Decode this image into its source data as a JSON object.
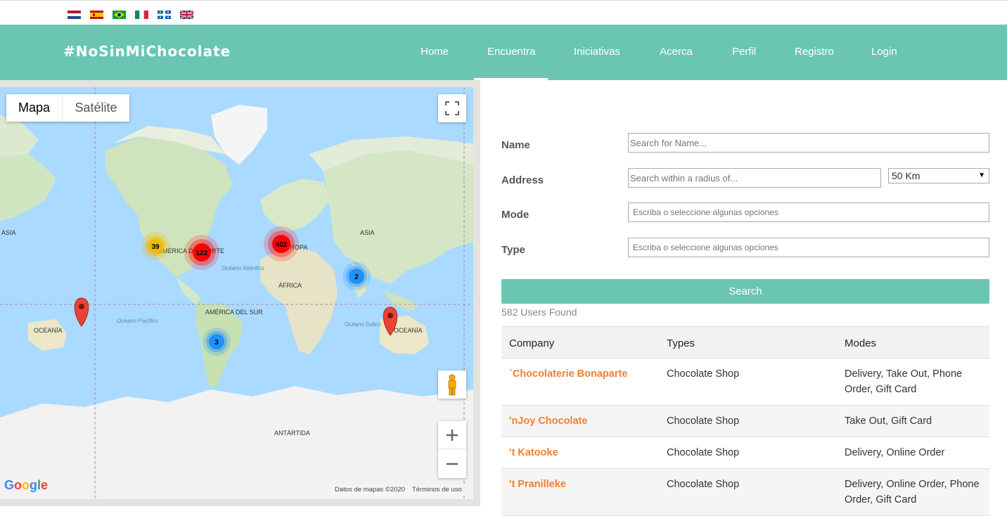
{
  "flags": [
    {
      "name": "dutch-flag-icon"
    },
    {
      "name": "spanish-flag-icon"
    },
    {
      "name": "brazilian-flag-icon"
    },
    {
      "name": "italian-flag-icon"
    },
    {
      "name": "quebec-flag-icon"
    },
    {
      "name": "uk-flag-icon"
    }
  ],
  "nav": {
    "brand": "#NoSinMiChocolate",
    "items": [
      "Home",
      "Encuentra",
      "Iniciativas",
      "Acerca",
      "Perfil",
      "Registro",
      "Login"
    ],
    "active": "Encuentra"
  },
  "map": {
    "type_buttons": [
      "Mapa",
      "Satélite"
    ],
    "labels": {
      "asia_left": "ASIA",
      "america_norte": "AMÉRICA DEL NORTE",
      "europa": "EUROPA",
      "asia": "ASIA",
      "oceano_atlantico": "Océano Atlántico",
      "africa": "ÁFRICA",
      "america_sur": "AMÉRICA DEL SUR",
      "oceania_left": "OCEANÍA",
      "oceania_right": "OCEANÍA",
      "oceano_pacifico": "Océano Pacífico",
      "oceano_indico": "Océano Índico",
      "antartida": "ANTÁRTIDA"
    },
    "clusters": [
      {
        "count": "39",
        "color": "#f5b800"
      },
      {
        "count": "122",
        "color": "#ff0000"
      },
      {
        "count": "402",
        "color": "#ff0000"
      },
      {
        "count": "2",
        "color": "#1e90ff"
      },
      {
        "count": "3",
        "color": "#1e90ff"
      }
    ],
    "google": "Google",
    "footer_data": "Datos de mapas ©2020",
    "footer_terms": "Términos de uso"
  },
  "form": {
    "name_label": "Name",
    "name_placeholder": "Search for Name...",
    "address_label": "Address",
    "address_placeholder": "Search within a radius of...",
    "radius_value": "50 Km",
    "mode_label": "Mode",
    "mode_placeholder": "Escriba o seleccione algunas opciones",
    "type_label": "Type",
    "type_placeholder": "Escriba o seleccione algunas opciones",
    "search_button": "Search",
    "found": "582 Users Found"
  },
  "table": {
    "headers": [
      "Company",
      "Types",
      "Modes"
    ],
    "rows": [
      {
        "company": "`Chocolaterie Bonaparte",
        "types": "Chocolate Shop",
        "modes": "Delivery, Take Out, Phone Order, Gift Card"
      },
      {
        "company": "'nJoy Chocolate",
        "types": "Chocolate Shop",
        "modes": "Take Out, Gift Card"
      },
      {
        "company": "'t Katooke",
        "types": "Chocolate Shop",
        "modes": "Delivery, Online Order"
      },
      {
        "company": "'t Pranilleke",
        "types": "Chocolate Shop",
        "modes": "Delivery, Online Order, Phone Order, Gift Card"
      }
    ]
  },
  "colors": {
    "brand": "#6ac6b2",
    "company_link": "#f08030"
  }
}
